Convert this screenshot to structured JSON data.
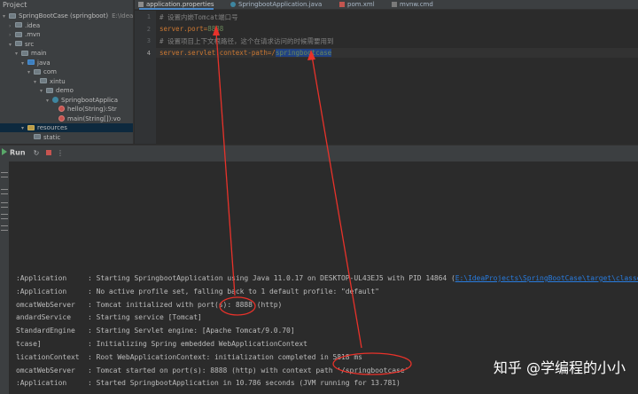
{
  "project": {
    "header": "Project",
    "tree": [
      {
        "label": "SpringBootCase (springboot)",
        "suffix": "E:\\IdeaP",
        "indent": 0,
        "arrow": "▾",
        "icon": "folder"
      },
      {
        "label": ".idea",
        "indent": 1,
        "arrow": "›",
        "icon": "folder"
      },
      {
        "label": ".mvn",
        "indent": 1,
        "arrow": "›",
        "icon": "folder"
      },
      {
        "label": "src",
        "indent": 1,
        "arrow": "▾",
        "icon": "folder"
      },
      {
        "label": "main",
        "indent": 2,
        "arrow": "▾",
        "icon": "folder"
      },
      {
        "label": "java",
        "indent": 3,
        "arrow": "▾",
        "icon": "folder-blue"
      },
      {
        "label": "com",
        "indent": 4,
        "arrow": "▾",
        "icon": "folder"
      },
      {
        "label": "xintu",
        "indent": 5,
        "arrow": "▾",
        "icon": "folder"
      },
      {
        "label": "demo",
        "indent": 6,
        "arrow": "▾",
        "icon": "folder"
      },
      {
        "label": "SpringbootApplica",
        "indent": 7,
        "arrow": "▾",
        "icon": "class"
      },
      {
        "label": "hello(String):Str",
        "indent": 8,
        "arrow": "",
        "icon": "method"
      },
      {
        "label": "main(String[]):vo",
        "indent": 8,
        "arrow": "",
        "icon": "method"
      },
      {
        "label": "resources",
        "indent": 3,
        "arrow": "▾",
        "icon": "folder-gold",
        "selected": true
      },
      {
        "label": "static",
        "indent": 4,
        "arrow": "",
        "icon": "folder"
      }
    ]
  },
  "tabs": [
    {
      "label": "application.properties",
      "active": true
    },
    {
      "label": "SpringbootApplication.java",
      "active": false
    },
    {
      "label": "pom.xml",
      "active": false
    },
    {
      "label": "mvnw.cmd",
      "active": false
    }
  ],
  "editor": {
    "line_numbers": [
      "1",
      "2",
      "3",
      "4"
    ],
    "line1": "# 设置内嵌Tomcat端口号",
    "line2_key": "server.port",
    "line2_eq": "=",
    "line2_val": "8888",
    "line3": "# 设置项目上下文根路径，这个在请求访问的时候需要用到",
    "line4_key": "server.servlet.context-path",
    "line4_eq": "=/",
    "line4_val": "springbootcase"
  },
  "run": {
    "tab_label": "Run",
    "log": [
      {
        "src": ":Application     ",
        "msg": ": Starting SpringbootApplication using Java 11.0.17 on DESKTOP-UL43EJ5 with PID 14864 (",
        "link": "E:\\IdeaProjects\\SpringBootCase\\target\\classes"
      },
      {
        "src": ":Application     ",
        "msg": ": No active profile set, falling back to 1 default profile: \"default\""
      },
      {
        "src": "omcatWebServer   ",
        "msg": ": Tomcat initialized with port(s): 8888 (http)"
      },
      {
        "src": "andardService    ",
        "msg": ": Starting service [Tomcat]"
      },
      {
        "src": "StandardEngine   ",
        "msg": ": Starting Servlet engine: [Apache Tomcat/9.0.70]"
      },
      {
        "src": "tcase]           ",
        "msg": ": Initializing Spring embedded WebApplicationContext"
      },
      {
        "src": "licationContext  ",
        "msg": ": Root WebApplicationContext: initialization completed in 5818 ms"
      },
      {
        "src": "omcatWebServer   ",
        "msg": ": Tomcat started on port(s): 8888 (http) with context path '/springbootcase'"
      },
      {
        "src": ":Application     ",
        "msg": ": Started SpringbootApplication in 10.786 seconds (JVM running for 13.781)"
      }
    ]
  },
  "watermark": "知乎 @学编程的小小",
  "colors": {
    "annotation": "#e8322a",
    "keyword": "#cc7832",
    "string": "#6a8759",
    "comment": "#808080",
    "link": "#287bde"
  }
}
